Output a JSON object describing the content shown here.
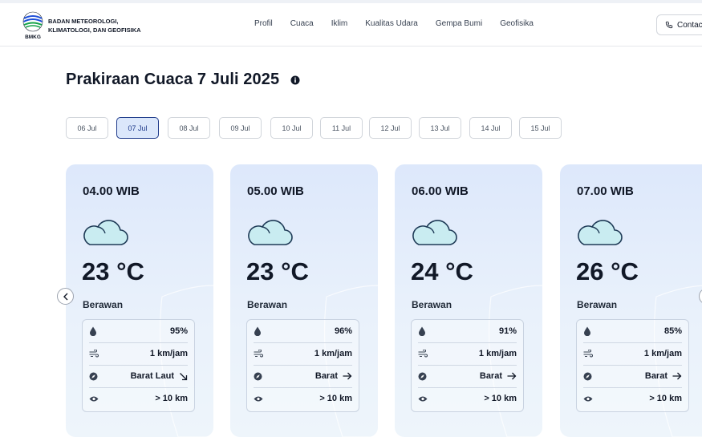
{
  "header": {
    "brand_line1": "BADAN METEOROLOGI,",
    "brand_line2": "KLIMATOLOGI, DAN GEOFISIKA",
    "logo_text": "BMKG",
    "nav": [
      "Profil",
      "Cuaca",
      "Iklim",
      "Kualitas Udara",
      "Gempa Bumi",
      "Geofisika"
    ],
    "contact_label": "Contact"
  },
  "page": {
    "title": "Prakiraan Cuaca 7 Juli 2025"
  },
  "dates": [
    "06 Jul",
    "07 Jul",
    "08 Jul",
    "09 Jul",
    "10 Jul",
    "11 Jul",
    "12 Jul",
    "13 Jul",
    "14 Jul",
    "15 Jul"
  ],
  "selected_date": "07 Jul",
  "forecasts": [
    {
      "time": "04.00 WIB",
      "temp": "23 °C",
      "condition": "Berawan",
      "humidity": "95%",
      "wind_speed": "1 km/jam",
      "wind_dir": "Barat Laut",
      "visibility": "> 10 km"
    },
    {
      "time": "05.00 WIB",
      "temp": "23 °C",
      "condition": "Berawan",
      "humidity": "96%",
      "wind_speed": "1 km/jam",
      "wind_dir": "Barat",
      "visibility": "> 10 km"
    },
    {
      "time": "06.00 WIB",
      "temp": "24 °C",
      "condition": "Berawan",
      "humidity": "91%",
      "wind_speed": "1 km/jam",
      "wind_dir": "Barat",
      "visibility": "> 10 km"
    },
    {
      "time": "07.00 WIB",
      "temp": "26 °C",
      "condition": "Berawan",
      "humidity": "85%",
      "wind_speed": "1 km/jam",
      "wind_dir": "Barat",
      "visibility": "> 10 km"
    }
  ],
  "icons": {
    "cloud": "cloud-icon",
    "humidity": "droplet-icon",
    "wind": "wind-icon",
    "direction": "compass-icon",
    "visibility": "eye-icon",
    "prev": "chevron-left-icon"
  },
  "colors": {
    "accent": "#1e3a8a",
    "selected_pill_bg": "#dbe7fb",
    "card_bg": "#e4edfb",
    "cloud_fill": "#c9ecf1"
  }
}
